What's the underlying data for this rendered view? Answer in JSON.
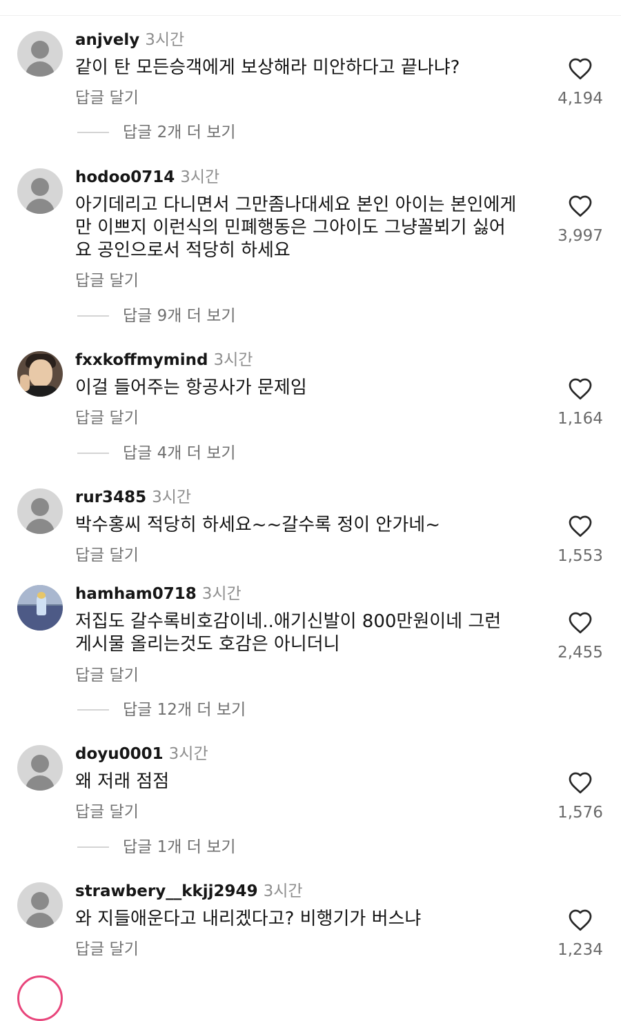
{
  "reply_label": "답글 달기",
  "comments": [
    {
      "username": "anjvely",
      "time": "3시간",
      "text": "같이 탄 모든승객에게 보상해라 미안하다고 끝나냐?",
      "likes": "4,194",
      "more_replies": "답글 2개 더 보기"
    },
    {
      "username": "hodoo0714",
      "time": "3시간",
      "text": "아기데리고 다니면서 그만좀나대세요 본인 아이는 본인에게\n만 이쁘지 이런식의 민폐행동은 그아이도 그냥꼴뵈기 싫어\n요 공인으로서 적당히 하세요",
      "likes": "3,997",
      "more_replies": "답글 9개 더 보기"
    },
    {
      "username": "fxxkoffmymind",
      "time": "3시간",
      "text": "이걸 들어주는 항공사가 문제임",
      "likes": "1,164",
      "more_replies": "답글 4개 더 보기"
    },
    {
      "username": "rur3485",
      "time": "3시간",
      "text": "박수홍씨  적당히  하세요~~갈수록  정이  안가네~",
      "likes": "1,553",
      "more_replies": ""
    },
    {
      "username": "hamham0718",
      "time": "3시간",
      "text": "저집도 갈수록비호감이네..애기신발이 800만원이네 그런\n게시물 올리는것도 호감은 아니더니",
      "likes": "2,455",
      "more_replies": "답글 12개 더 보기"
    },
    {
      "username": "doyu0001",
      "time": "3시간",
      "text": "왜 저래 점점",
      "likes": "1,576",
      "more_replies": "답글 1개 더 보기"
    },
    {
      "username": "strawbery__kkjj2949",
      "time": "3시간",
      "text": "와 지들애운다고 내리겠다고?  비행기가 버스냐",
      "likes": "1,234",
      "more_replies": ""
    }
  ]
}
